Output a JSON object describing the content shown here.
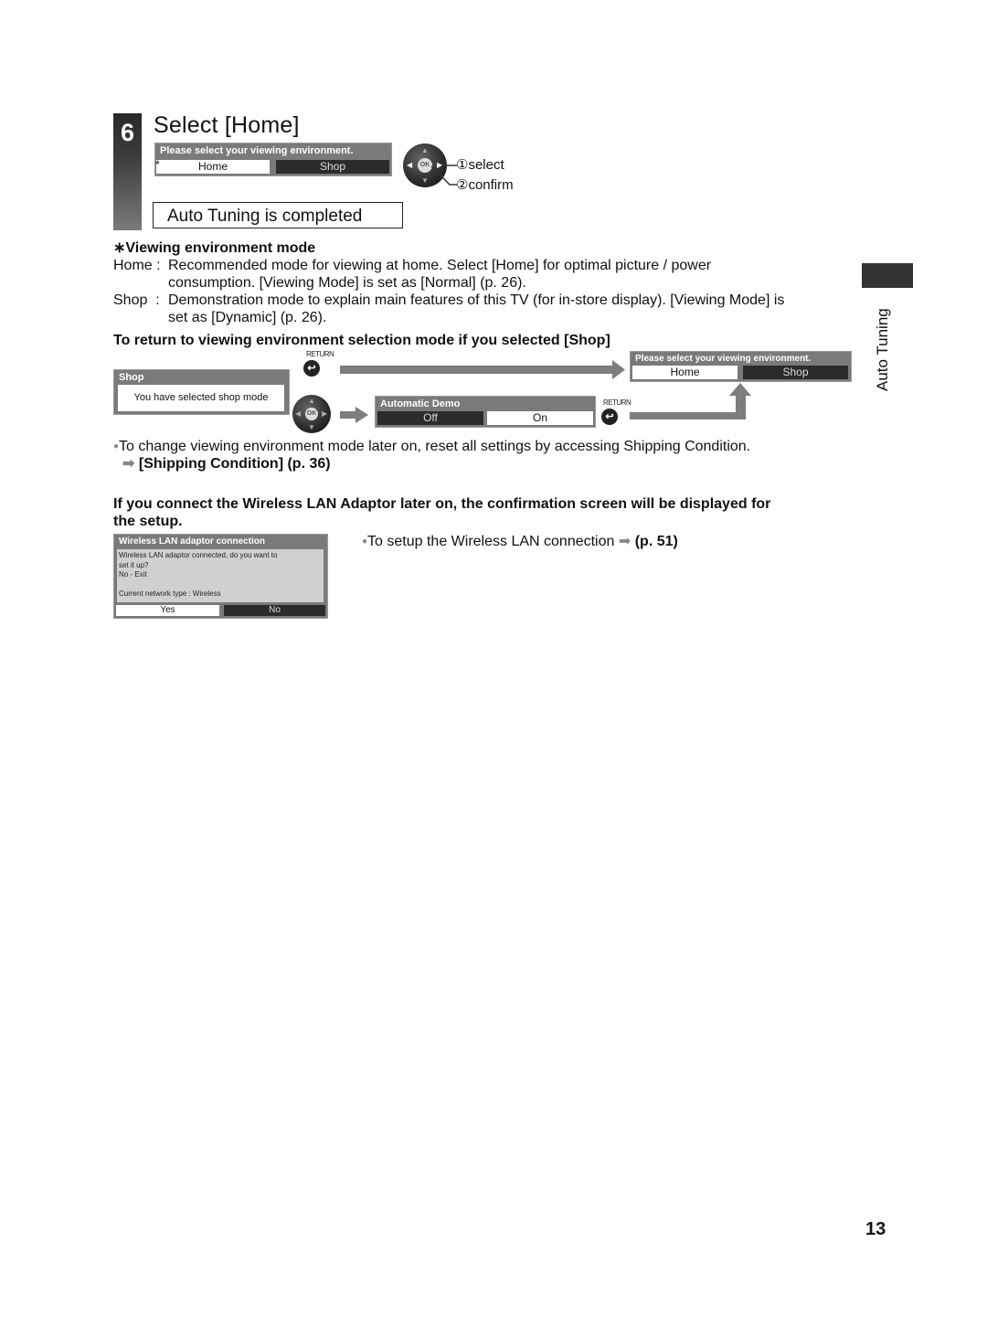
{
  "step": {
    "number": "6",
    "title": "Select [Home]"
  },
  "env_menu": {
    "header": "Please select your viewing environment.",
    "asterisk": "*",
    "options": [
      "Home",
      "Shop"
    ],
    "selected": "Home"
  },
  "remote_hint": {
    "ok_label": "OK",
    "select": "①select",
    "confirm": "②confirm"
  },
  "completed_box": "Auto Tuning is completed",
  "viewing_env": {
    "heading": "∗Viewing environment mode",
    "items": [
      {
        "term": "Home :",
        "line1": "Recommended mode for viewing at home. Select [Home] for optimal picture / power",
        "line2": "consumption. [Viewing Mode] is set as [Normal] (p. 26)."
      },
      {
        "term": "Shop  :",
        "line1": "Demonstration mode to explain main features of this TV (for in-store display). [Viewing Mode] is",
        "line2": "set as [Dynamic] (p. 26)."
      }
    ]
  },
  "return_section": {
    "heading": "To return to viewing environment selection mode if you selected [Shop]",
    "shop_box": {
      "header": "Shop",
      "message": "You have selected shop mode"
    },
    "return_label": "RETURN",
    "demo_menu": {
      "header": "Automatic Demo",
      "options": [
        "Off",
        "On"
      ],
      "selected": "Off"
    },
    "env_menu": {
      "header": "Please select your viewing environment.",
      "options": [
        "Home",
        "Shop"
      ],
      "selected": "Home"
    }
  },
  "note": {
    "bullet": "To change viewing environment mode later on, reset all settings by accessing Shipping Condition.",
    "link": "[Shipping Condition] (p. 36)"
  },
  "wireless": {
    "heading_line1": "If you connect the Wireless LAN Adaptor later on, the confirmation screen will be displayed for",
    "heading_line2": "the setup.",
    "dialog": {
      "header": "Wireless LAN adaptor connection",
      "line1": "Wireless LAN adaptor connected, do you want to",
      "line2": "set it up?",
      "line3": "No - Exit",
      "line4": "Current network type : Wireless",
      "options": [
        "Yes",
        "No"
      ],
      "selected": "Yes"
    },
    "bullet": "To setup the Wireless LAN connection",
    "page_ref": "(p. 51)"
  },
  "side_tab": "Auto Tuning",
  "page_number": "13"
}
